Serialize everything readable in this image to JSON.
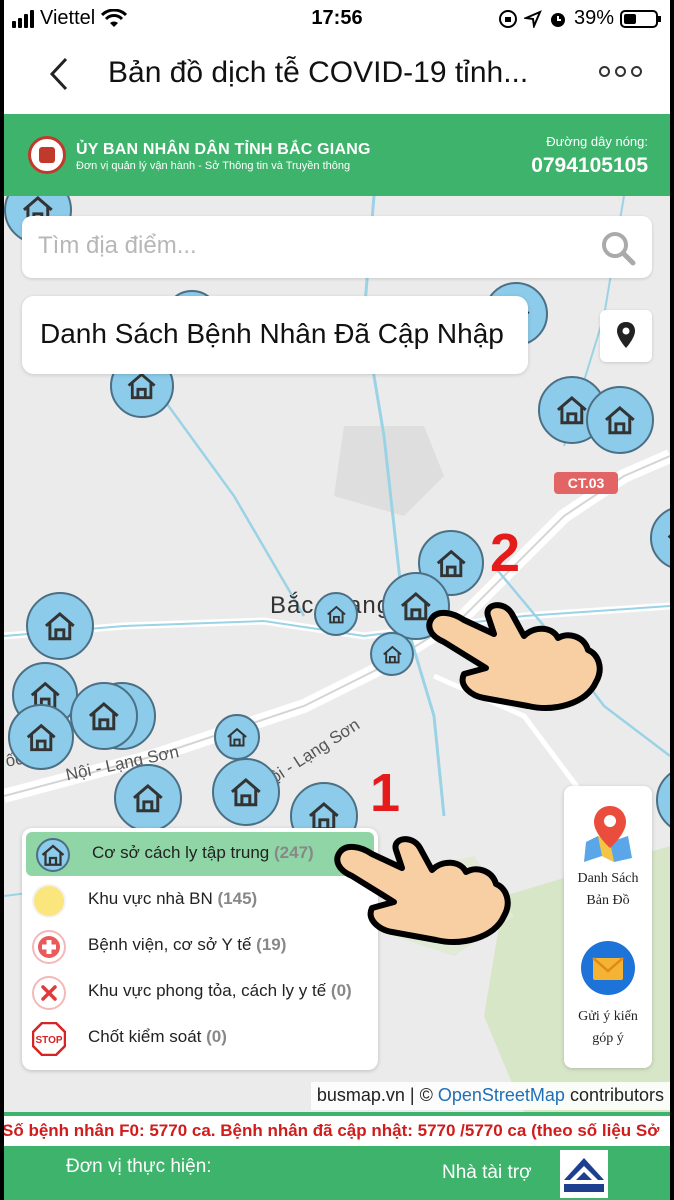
{
  "status_bar": {
    "carrier": "Viettel",
    "time": "17:56",
    "battery": "39%"
  },
  "titlebar": {
    "title": "Bản đồ dịch tễ COVID-19 tỉnh...",
    "back_icon": "chevron-left-icon",
    "more_icon": "more-horizontal-icon"
  },
  "header": {
    "org": "ỦY BAN NHÂN DÂN TỈNH BẮC GIANG",
    "subtitle": "Đơn vị quản lý vận hành - Sở Thông tin và Truyền thông",
    "hotline_label": "Đường dây nóng:",
    "hotline_number": "0794105105",
    "brand_color": "#3db36b"
  },
  "search": {
    "placeholder": "Tìm địa điểm..."
  },
  "list_button": {
    "label": "Danh Sách Bệnh Nhân Đã Cập Nhập"
  },
  "map": {
    "road_badge": "CT.03",
    "city_label": "Bắc Giang",
    "road_label_1": "Nội - Lạng Sơn",
    "road_label_2": "Hà Nội - Lạng Sơn",
    "road_label_3": "ốc lộ",
    "annotation_1": "1",
    "annotation_2": "2",
    "attribution_prefix": "busmap.vn | ©",
    "attribution_link": "OpenStreetMap",
    "attribution_suffix": "contributors"
  },
  "legend": [
    {
      "label": "Cơ sở cách ly tập trung",
      "count": "(247)",
      "icon": "house-icon",
      "active": true
    },
    {
      "label": "Khu vực nhà BN",
      "count": "(145)",
      "icon": "yellow-circle-icon",
      "active": false
    },
    {
      "label": "Bệnh viện, cơ sở Y tế",
      "count": "(19)",
      "icon": "hospital-cross-icon",
      "active": false
    },
    {
      "label": "Khu vực phong tỏa, cách ly y tế",
      "count": "(0)",
      "icon": "lockdown-x-icon",
      "active": false
    },
    {
      "label": "Chốt kiểm soát",
      "count": "(0)",
      "icon": "stop-sign-icon",
      "active": false
    }
  ],
  "side_panel": {
    "map_list_line1": "Danh Sách",
    "map_list_line2": "Bản Đồ",
    "feedback_line1": "Gửi ý kiến",
    "feedback_line2": "góp ý"
  },
  "ticker": {
    "text": "Số bệnh nhân F0: 5770 ca. Bệnh nhân đã cập nhật: 5770 /5770  ca (theo số liệu Sở"
  },
  "footer": {
    "left_label": "Đơn vị thực hiện:",
    "right_label": "Nhà tài trợ"
  }
}
